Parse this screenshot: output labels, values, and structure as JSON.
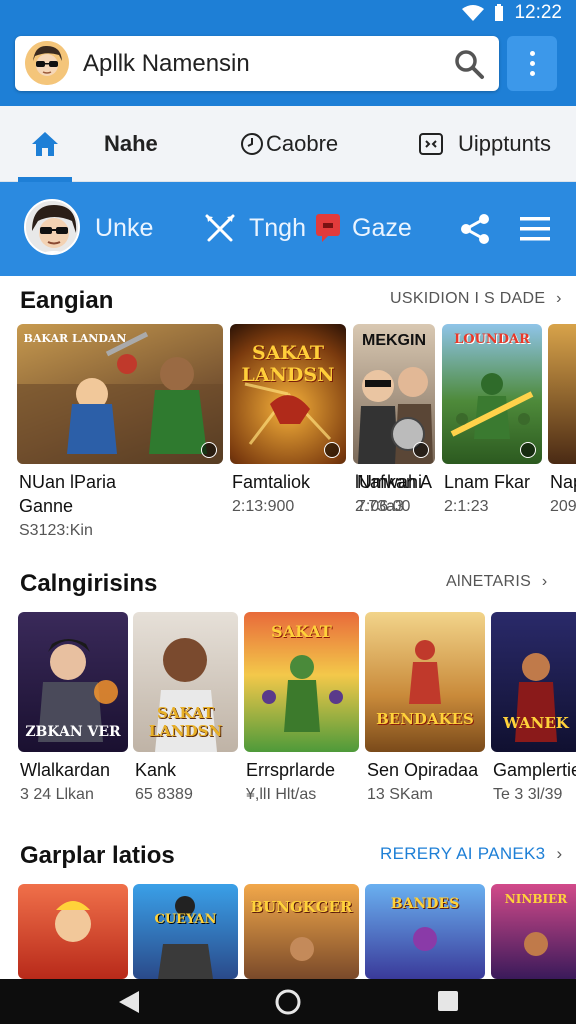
{
  "status_bar": {
    "time": "12:22"
  },
  "search": {
    "text": "Apllk Namensin"
  },
  "tabs": [
    {
      "label": "Nahe"
    },
    {
      "label": "Caobre"
    },
    {
      "label": "Uipptunts"
    }
  ],
  "action_bar": {
    "label1": "Unke",
    "label2": "Tngh",
    "label3": "Gaze"
  },
  "section1": {
    "title": "Eangian",
    "link": "USKIDION I S DADE",
    "cards": [
      {
        "art": "BAKAR LANDAN",
        "title": "NUan lParia",
        "title2": "Ganne",
        "sub": "S3123:Kin"
      },
      {
        "art": "SAKAT LANDSN",
        "title": "Famtaliok",
        "sub": "2:13:900"
      },
      {
        "art": "MEKGIN",
        "title": "lUmkan A",
        "sub": "2.73a3"
      },
      {
        "art": "LOUNDAR",
        "title": "Nafwahi",
        "sub": "7:06:00"
      },
      {
        "art": "",
        "title": "Lnam Fkar",
        "sub": "2:1:23"
      },
      {
        "art": "",
        "title": "Nap",
        "sub": "209"
      }
    ]
  },
  "section2": {
    "title": "Calngirisins",
    "link": "AlNETARIS",
    "cards": [
      {
        "art": "ZBKAN VER",
        "title": "Wlalkardan",
        "sub": "3 24 Llkan"
      },
      {
        "art": "SAKAT LANDSN",
        "title": "Kank",
        "sub": "65 8389"
      },
      {
        "art": "SAKAT",
        "title": "Errsprlarde",
        "sub": "¥,llI Hlt/as"
      },
      {
        "art": "BENDAKES",
        "title": "Sen Opiradaa",
        "sub": "13 SKam"
      },
      {
        "art": "WANEK",
        "title": "Gamplertie",
        "sub": "Te 3 3l/39"
      }
    ]
  },
  "section3": {
    "title": "Garplar latios",
    "link": "RERERY AI PANEK3",
    "cards": [
      {
        "art": ""
      },
      {
        "art": "CUEYAN"
      },
      {
        "art": "BUNGKGER"
      },
      {
        "art": "BANDES"
      },
      {
        "art": "NINBIER"
      }
    ]
  },
  "colors": {
    "primary": "#1e7fd6",
    "action_bar": "#2b8ae0",
    "link_blue": "#1e7fd6"
  }
}
